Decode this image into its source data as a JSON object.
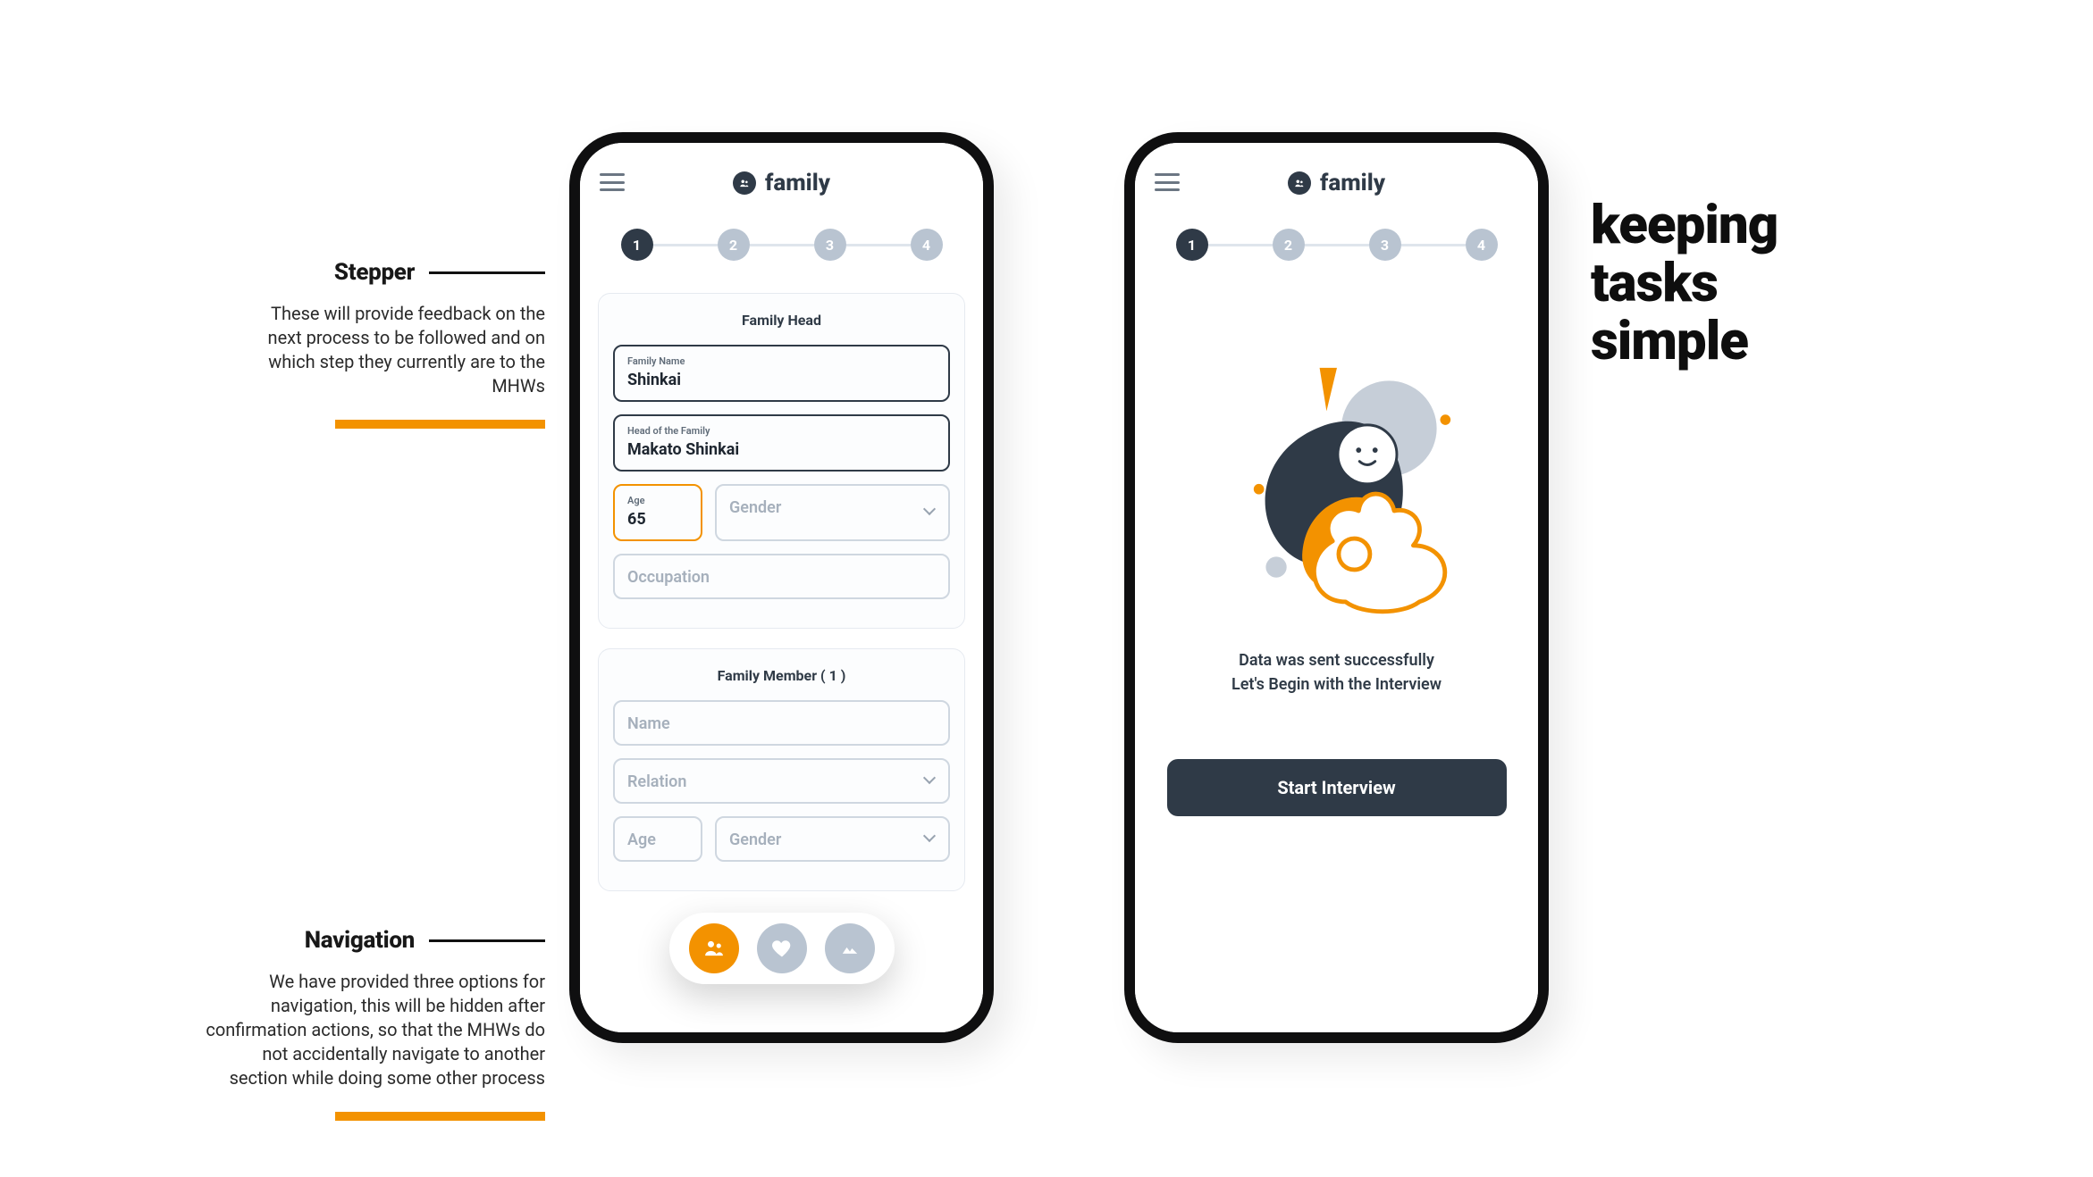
{
  "annotations": {
    "stepper": {
      "title": "Stepper",
      "body": "These will provide feedback on the next process to be followed and on which step they currently are to the MHWs"
    },
    "navigation": {
      "title": "Navigation",
      "body": "We have provided three options for navigation, this will be hidden after confirmation actions, so that the MHWs do not accidentally navigate to another section while doing some other process"
    }
  },
  "heading": "keeping\ntasks\nsimple",
  "app": {
    "brand": "family",
    "stepper": {
      "steps": [
        "1",
        "2",
        "3",
        "4"
      ],
      "active_index": 0
    }
  },
  "form": {
    "family_head_title": "Family Head",
    "family_name_label": "Family Name",
    "family_name_value": "Shinkai",
    "head_label": "Head of the Family",
    "head_value": "Makato Shinkai",
    "age_label": "Age",
    "age_value": "65",
    "gender_placeholder": "Gender",
    "occupation_placeholder": "Occupation",
    "member_title": "Family Member ( 1 )",
    "member_name_placeholder": "Name",
    "member_relation_placeholder": "Relation",
    "member_age_placeholder": "Age",
    "member_gender_placeholder": "Gender"
  },
  "success": {
    "line1": "Data was sent successfully",
    "line2": "Let's Begin with the Interview",
    "cta": "Start Interview"
  }
}
